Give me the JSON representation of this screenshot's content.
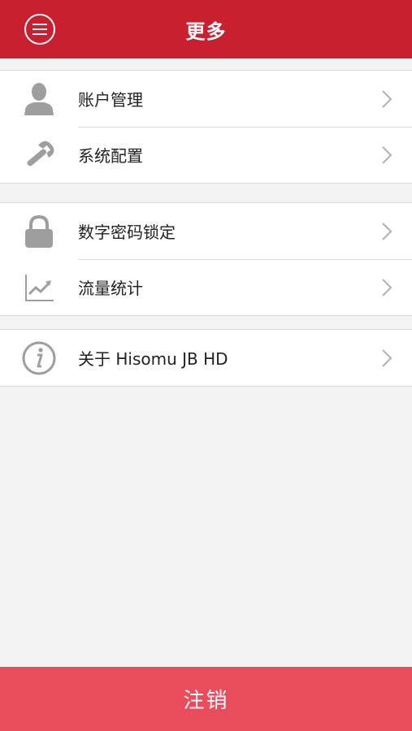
{
  "colors": {
    "header": "#c8202f",
    "logout": "#e94d5c",
    "icon": "#9e9e9e"
  },
  "header": {
    "title": "更多",
    "menu_icon": "menu-icon"
  },
  "groups": [
    {
      "items": [
        {
          "icon": "person-icon",
          "label": "账户管理"
        },
        {
          "icon": "wrench-icon",
          "label": "系统配置"
        }
      ]
    },
    {
      "items": [
        {
          "icon": "lock-icon",
          "label": "数字密码锁定"
        },
        {
          "icon": "chart-line-icon",
          "label": "流量统计"
        }
      ]
    },
    {
      "items": [
        {
          "icon": "info-icon",
          "label": "关于 Hisomu JB HD"
        }
      ]
    }
  ],
  "footer": {
    "logout_label": "注销"
  }
}
